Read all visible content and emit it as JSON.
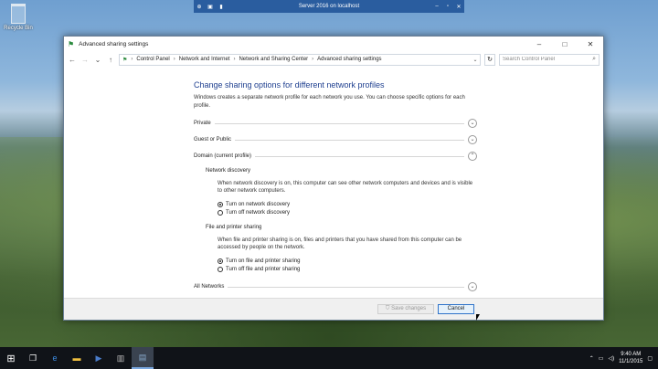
{
  "desktop": {
    "recycle_bin_label": "Recycle Bin"
  },
  "remote_bar": {
    "title": "Server 2016 on localhost"
  },
  "window": {
    "title": "Advanced sharing settings",
    "breadcrumb": [
      "Control Panel",
      "Network and Internet",
      "Network and Sharing Center",
      "Advanced sharing settings"
    ],
    "search_placeholder": "Search Control Panel"
  },
  "content": {
    "heading": "Change sharing options for different network profiles",
    "intro": "Windows creates a separate network profile for each network you use. You can choose specific options for each profile.",
    "profiles": {
      "private": "Private",
      "guest": "Guest or Public",
      "domain": "Domain (current profile)",
      "all": "All Networks"
    },
    "network_discovery": {
      "title": "Network discovery",
      "description": "When network discovery is on, this computer can see other network computers and devices and is visible to other network computers.",
      "on_label": "Turn on network discovery",
      "off_label": "Turn off network discovery",
      "selected": "on"
    },
    "file_sharing": {
      "title": "File and printer sharing",
      "description": "When file and printer sharing is on, files and printers that you have shared from this computer can be accessed by people on the network.",
      "on_label": "Turn on file and printer sharing",
      "off_label": "Turn off file and printer sharing",
      "selected": "on"
    }
  },
  "footer": {
    "save_label": "Save changes",
    "cancel_label": "Cancel"
  },
  "taskbar": {
    "time": "9:40 AM",
    "date": "11/1/2015"
  }
}
